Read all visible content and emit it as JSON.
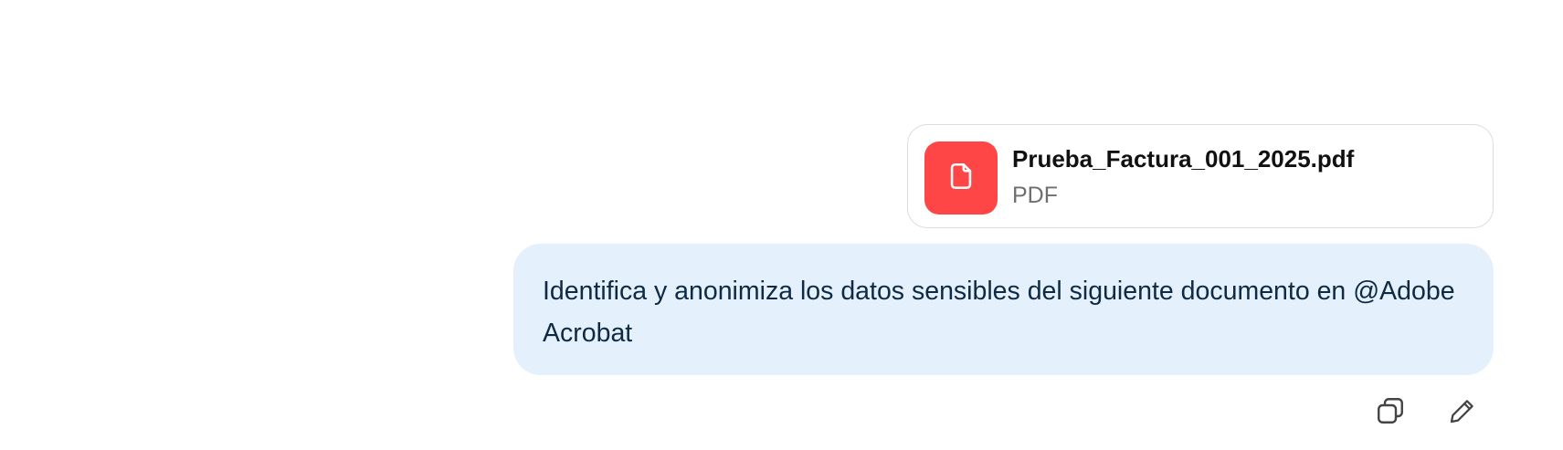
{
  "attachment": {
    "file_name": "Prueba_Factura_001_2025.pdf",
    "file_type": "PDF",
    "icon": "document-icon",
    "icon_bg_color": "#ff4646"
  },
  "message": {
    "text": "Identifica y anonimiza los datos sensibles del siguiente documento en @Adobe Acrobat",
    "bubble_color": "#e4f0fb"
  },
  "actions": {
    "copy_icon": "copy-icon",
    "edit_icon": "pencil-icon"
  }
}
